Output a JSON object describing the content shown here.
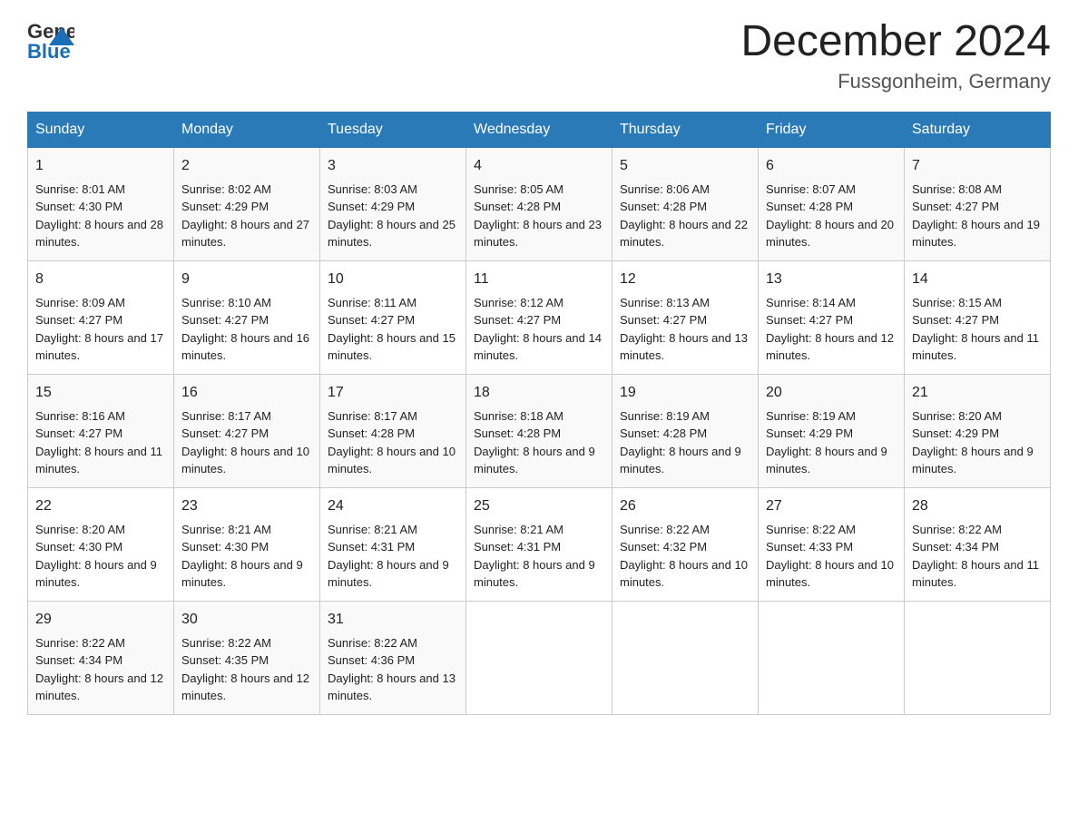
{
  "header": {
    "logo_general": "General",
    "logo_blue": "Blue",
    "month": "December 2024",
    "location": "Fussgonheim, Germany"
  },
  "days_of_week": [
    "Sunday",
    "Monday",
    "Tuesday",
    "Wednesday",
    "Thursday",
    "Friday",
    "Saturday"
  ],
  "weeks": [
    [
      {
        "day": "1",
        "sunrise": "8:01 AM",
        "sunset": "4:30 PM",
        "daylight": "8 hours and 28 minutes."
      },
      {
        "day": "2",
        "sunrise": "8:02 AM",
        "sunset": "4:29 PM",
        "daylight": "8 hours and 27 minutes."
      },
      {
        "day": "3",
        "sunrise": "8:03 AM",
        "sunset": "4:29 PM",
        "daylight": "8 hours and 25 minutes."
      },
      {
        "day": "4",
        "sunrise": "8:05 AM",
        "sunset": "4:28 PM",
        "daylight": "8 hours and 23 minutes."
      },
      {
        "day": "5",
        "sunrise": "8:06 AM",
        "sunset": "4:28 PM",
        "daylight": "8 hours and 22 minutes."
      },
      {
        "day": "6",
        "sunrise": "8:07 AM",
        "sunset": "4:28 PM",
        "daylight": "8 hours and 20 minutes."
      },
      {
        "day": "7",
        "sunrise": "8:08 AM",
        "sunset": "4:27 PM",
        "daylight": "8 hours and 19 minutes."
      }
    ],
    [
      {
        "day": "8",
        "sunrise": "8:09 AM",
        "sunset": "4:27 PM",
        "daylight": "8 hours and 17 minutes."
      },
      {
        "day": "9",
        "sunrise": "8:10 AM",
        "sunset": "4:27 PM",
        "daylight": "8 hours and 16 minutes."
      },
      {
        "day": "10",
        "sunrise": "8:11 AM",
        "sunset": "4:27 PM",
        "daylight": "8 hours and 15 minutes."
      },
      {
        "day": "11",
        "sunrise": "8:12 AM",
        "sunset": "4:27 PM",
        "daylight": "8 hours and 14 minutes."
      },
      {
        "day": "12",
        "sunrise": "8:13 AM",
        "sunset": "4:27 PM",
        "daylight": "8 hours and 13 minutes."
      },
      {
        "day": "13",
        "sunrise": "8:14 AM",
        "sunset": "4:27 PM",
        "daylight": "8 hours and 12 minutes."
      },
      {
        "day": "14",
        "sunrise": "8:15 AM",
        "sunset": "4:27 PM",
        "daylight": "8 hours and 11 minutes."
      }
    ],
    [
      {
        "day": "15",
        "sunrise": "8:16 AM",
        "sunset": "4:27 PM",
        "daylight": "8 hours and 11 minutes."
      },
      {
        "day": "16",
        "sunrise": "8:17 AM",
        "sunset": "4:27 PM",
        "daylight": "8 hours and 10 minutes."
      },
      {
        "day": "17",
        "sunrise": "8:17 AM",
        "sunset": "4:28 PM",
        "daylight": "8 hours and 10 minutes."
      },
      {
        "day": "18",
        "sunrise": "8:18 AM",
        "sunset": "4:28 PM",
        "daylight": "8 hours and 9 minutes."
      },
      {
        "day": "19",
        "sunrise": "8:19 AM",
        "sunset": "4:28 PM",
        "daylight": "8 hours and 9 minutes."
      },
      {
        "day": "20",
        "sunrise": "8:19 AM",
        "sunset": "4:29 PM",
        "daylight": "8 hours and 9 minutes."
      },
      {
        "day": "21",
        "sunrise": "8:20 AM",
        "sunset": "4:29 PM",
        "daylight": "8 hours and 9 minutes."
      }
    ],
    [
      {
        "day": "22",
        "sunrise": "8:20 AM",
        "sunset": "4:30 PM",
        "daylight": "8 hours and 9 minutes."
      },
      {
        "day": "23",
        "sunrise": "8:21 AM",
        "sunset": "4:30 PM",
        "daylight": "8 hours and 9 minutes."
      },
      {
        "day": "24",
        "sunrise": "8:21 AM",
        "sunset": "4:31 PM",
        "daylight": "8 hours and 9 minutes."
      },
      {
        "day": "25",
        "sunrise": "8:21 AM",
        "sunset": "4:31 PM",
        "daylight": "8 hours and 9 minutes."
      },
      {
        "day": "26",
        "sunrise": "8:22 AM",
        "sunset": "4:32 PM",
        "daylight": "8 hours and 10 minutes."
      },
      {
        "day": "27",
        "sunrise": "8:22 AM",
        "sunset": "4:33 PM",
        "daylight": "8 hours and 10 minutes."
      },
      {
        "day": "28",
        "sunrise": "8:22 AM",
        "sunset": "4:34 PM",
        "daylight": "8 hours and 11 minutes."
      }
    ],
    [
      {
        "day": "29",
        "sunrise": "8:22 AM",
        "sunset": "4:34 PM",
        "daylight": "8 hours and 12 minutes."
      },
      {
        "day": "30",
        "sunrise": "8:22 AM",
        "sunset": "4:35 PM",
        "daylight": "8 hours and 12 minutes."
      },
      {
        "day": "31",
        "sunrise": "8:22 AM",
        "sunset": "4:36 PM",
        "daylight": "8 hours and 13 minutes."
      },
      null,
      null,
      null,
      null
    ]
  ],
  "labels": {
    "sunrise": "Sunrise:",
    "sunset": "Sunset:",
    "daylight": "Daylight:"
  }
}
